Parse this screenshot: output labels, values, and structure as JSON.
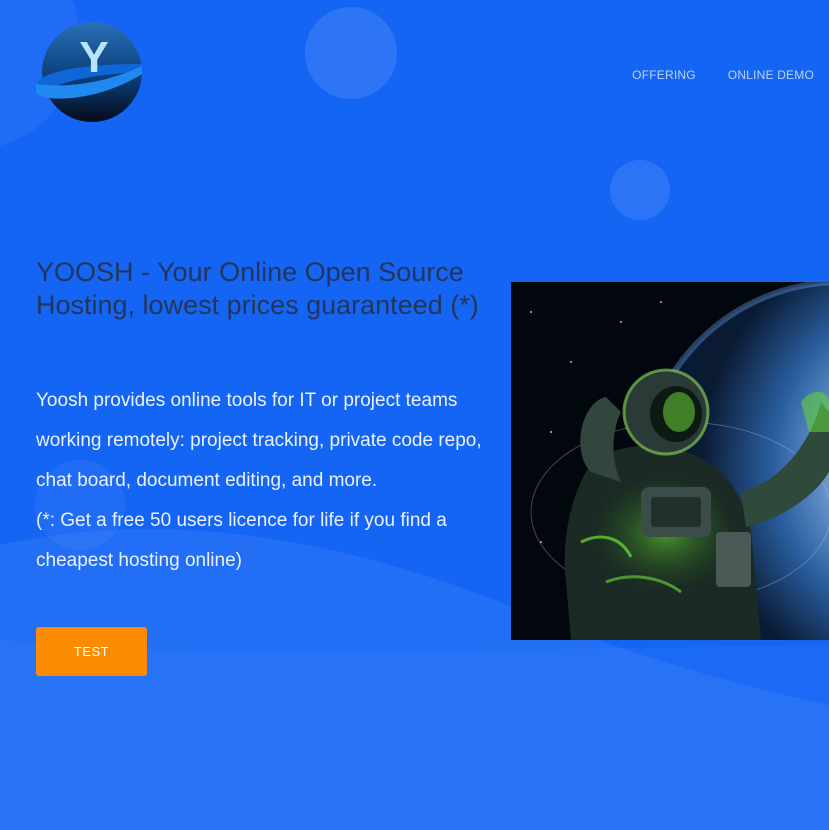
{
  "colors": {
    "background": "#1565f5",
    "title": "#24355c",
    "description": "#eaf1ff",
    "nav": "#bcd2f6",
    "cta_background": "#fd8c05",
    "cta_text": "#ffffff"
  },
  "logo": {
    "letter": "Y"
  },
  "nav": {
    "items": [
      {
        "label": "OFFERING"
      },
      {
        "label": "ONLINE DEMO"
      }
    ]
  },
  "hero": {
    "title": "YOOSH - Your Online Open Source Hosting, lowest prices guaranteed (*)",
    "description": "Yoosh provides online tools for IT or project teams working remotely: project tracking, private code repo, chat board, document editing, and more.",
    "footnote": "(*: Get a free 50 users licence for life if you find a cheapest hosting online)",
    "cta_label": "TEST",
    "image_icon": "astronaut-illustration"
  }
}
